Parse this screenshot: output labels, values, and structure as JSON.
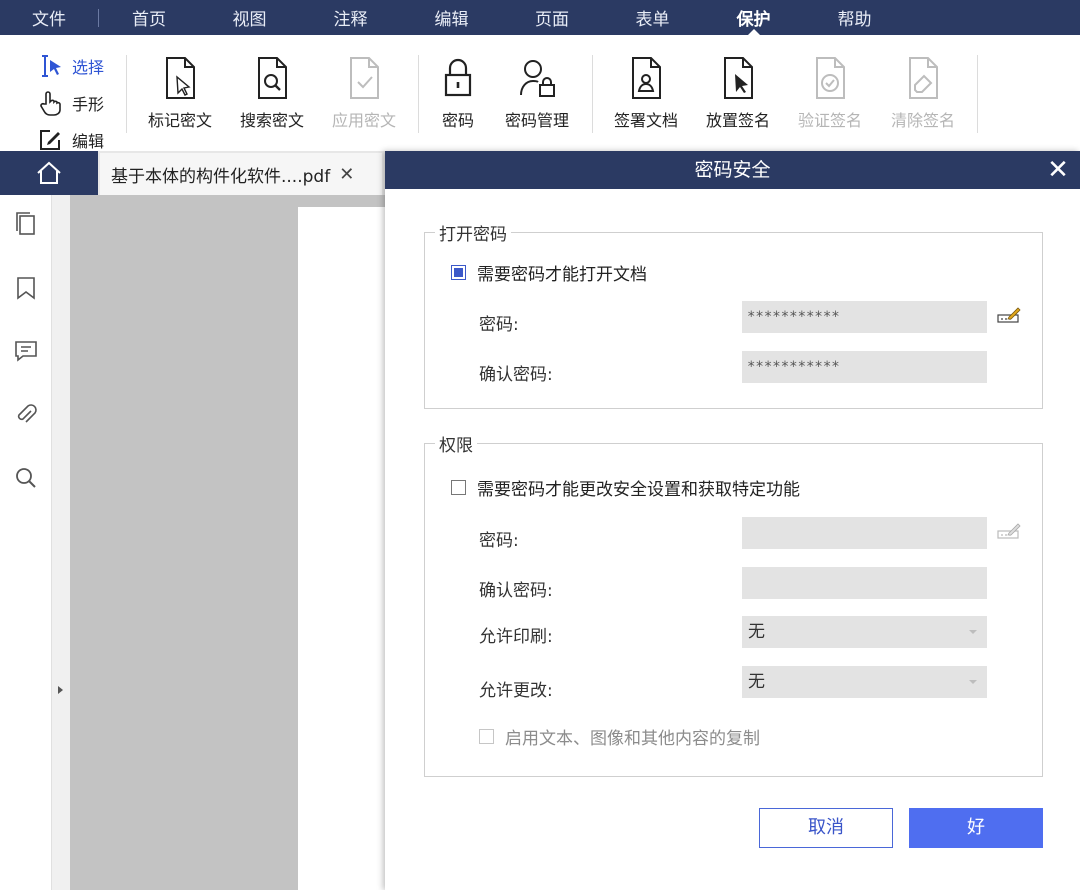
{
  "menu": {
    "items": [
      {
        "label": "文件",
        "active": false
      },
      {
        "label": "首页",
        "active": false
      },
      {
        "label": "视图",
        "active": false
      },
      {
        "label": "注释",
        "active": false
      },
      {
        "label": "编辑",
        "active": false
      },
      {
        "label": "页面",
        "active": false
      },
      {
        "label": "表单",
        "active": false
      },
      {
        "label": "保护",
        "active": true
      },
      {
        "label": "帮助",
        "active": false
      }
    ]
  },
  "toolbar": {
    "modes": [
      {
        "label": "选择",
        "icon": "text-cursor-select-icon",
        "selected": true
      },
      {
        "label": "手形",
        "icon": "hand-icon",
        "selected": false
      },
      {
        "label": "编辑",
        "icon": "edit-icon",
        "selected": false
      }
    ],
    "tools": [
      {
        "label": "标记密文",
        "icon": "mark-redaction-icon",
        "enabled": true
      },
      {
        "label": "搜索密文",
        "icon": "search-redaction-icon",
        "enabled": true
      },
      {
        "label": "应用密文",
        "icon": "apply-redaction-icon",
        "enabled": false
      },
      {
        "label": "密码",
        "icon": "lock-icon",
        "enabled": true
      },
      {
        "label": "密码管理",
        "icon": "password-manager-icon",
        "enabled": true
      },
      {
        "label": "签署文档",
        "icon": "sign-document-icon",
        "enabled": true
      },
      {
        "label": "放置签名",
        "icon": "place-signature-icon",
        "enabled": true
      },
      {
        "label": "验证签名",
        "icon": "verify-signature-icon",
        "enabled": false
      },
      {
        "label": "清除签名",
        "icon": "clear-signature-icon",
        "enabled": false
      }
    ]
  },
  "tabs": {
    "home_icon": "home-icon",
    "document_tab": "基于本体的构件化软件....pdf",
    "close": "✕"
  },
  "sidebar": {
    "icons": [
      "pages-icon",
      "bookmark-icon",
      "comment-icon",
      "attachment-icon",
      "search-icon"
    ]
  },
  "dialog": {
    "title": "密码安全",
    "close": "✕",
    "open_password": {
      "legend": "打开密码",
      "checkbox_label": "需要密码才能打开文档",
      "checked": true,
      "password_label": "密码:",
      "password_value": "***********",
      "confirm_label": "确认密码:",
      "confirm_value": "***********"
    },
    "permissions": {
      "legend": "权限",
      "checkbox_label": "需要密码才能更改安全设置和获取特定功能",
      "checked": false,
      "password_label": "密码:",
      "password_value": "",
      "confirm_label": "确认密码:",
      "confirm_value": "",
      "print_label": "允许印刷:",
      "print_value": "无",
      "change_label": "允许更改:",
      "change_value": "无",
      "copy_label": "启用文本、图像和其他内容的复制",
      "copy_checked": false
    },
    "cancel_label": "取消",
    "ok_label": "好"
  },
  "colors": {
    "nav_bg": "#2b3a63",
    "accent": "#4f6ef0"
  }
}
